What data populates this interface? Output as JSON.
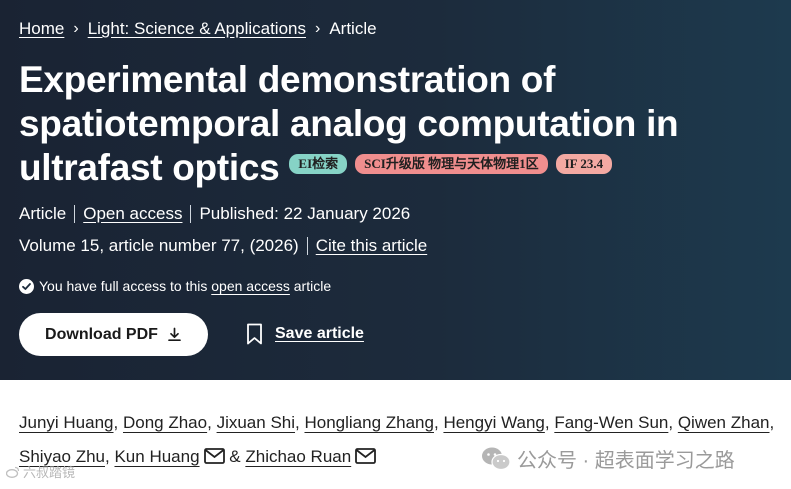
{
  "breadcrumb": {
    "home": "Home",
    "journal": "Light: Science & Applications",
    "current": "Article",
    "separator": "›"
  },
  "article": {
    "title": "Experimental demonstration of spatiotemporal analog computation in ultrafast optics",
    "badges": [
      {
        "label": "EI检索",
        "color": "#86d3c6"
      },
      {
        "label": "SCI升级版 物理与天体物理1区",
        "color": "#f08e8e"
      },
      {
        "label": "IF 23.4",
        "color": "#f3a9a2"
      }
    ],
    "type": "Article",
    "open_access": "Open access",
    "published": "Published: 22 January 2026",
    "volume": "Volume 15, article number 77, (2026)",
    "cite": "Cite this article",
    "access_prefix": "You have full access to this",
    "access_link": "open access",
    "access_suffix": "article"
  },
  "actions": {
    "download": "Download PDF",
    "save": "Save article"
  },
  "authors": [
    {
      "name": "Junyi Huang",
      "sep": ","
    },
    {
      "name": "Dong Zhao",
      "sep": ","
    },
    {
      "name": "Jixuan Shi",
      "sep": ","
    },
    {
      "name": "Hongliang Zhang",
      "sep": ","
    },
    {
      "name": "Hengyi Wang",
      "sep": ","
    },
    {
      "name": "Fang-Wen Sun",
      "sep": ","
    },
    {
      "name": "Qiwen Zhan",
      "sep": ","
    },
    {
      "name": "Shiyao Zhu",
      "sep": ","
    },
    {
      "name": "Kun Huang",
      "sep": "&",
      "mail": true
    },
    {
      "name": "Zhichao Ruan",
      "sep": "",
      "mail": true
    }
  ],
  "watermarks": {
    "left": "六叔踏镜",
    "right": "公众号 · 超表面学习之路"
  },
  "colors": {
    "hero_start": "#1a2333",
    "hero_end": "#1d3a4e"
  },
  "icons": [
    "chevron-right-icon",
    "check-circle-icon",
    "download-icon",
    "bookmark-icon",
    "mail-icon",
    "wechat-icon"
  ]
}
